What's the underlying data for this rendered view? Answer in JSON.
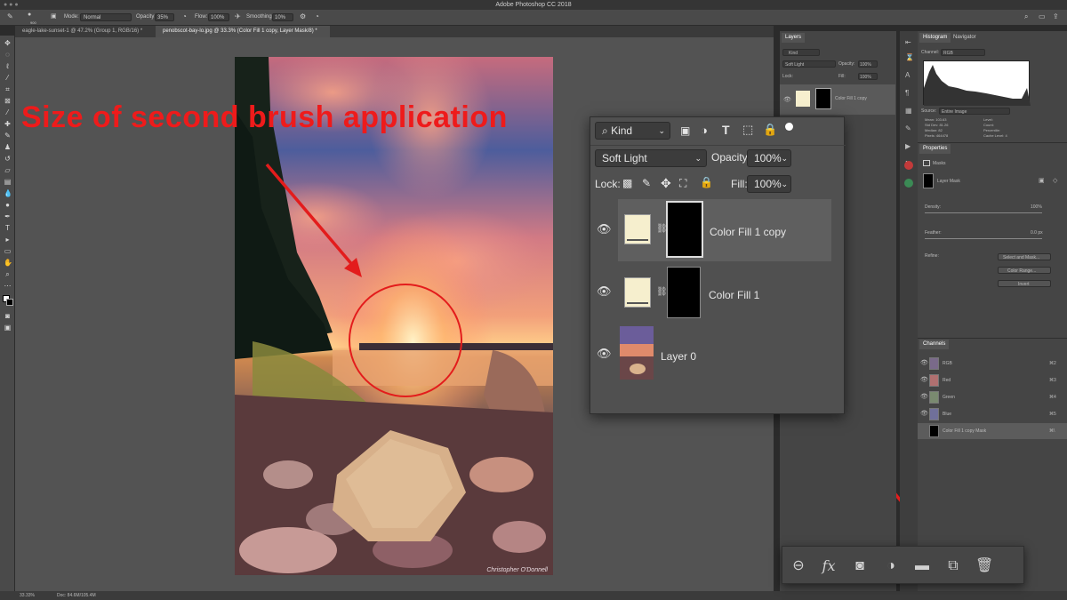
{
  "app": {
    "title": "Adobe Photoshop CC 2018"
  },
  "options_bar": {
    "brush_size": "900",
    "mode_label": "Mode:",
    "mode_value": "Normal",
    "opacity_label": "Opacity:",
    "opacity_value": "35%",
    "flow_label": "Flow:",
    "flow_value": "100%",
    "smoothing_label": "Smoothing:",
    "smoothing_value": "10%"
  },
  "tabs": [
    {
      "label": "eagle-lake-sunset-1 @ 47.2% (Group 1, RGB/16) *"
    },
    {
      "label": "penobscot-bay-lo.jpg @ 33.3% (Color Fill 1 copy, Layer Mask/8) *"
    }
  ],
  "annotation": {
    "text": "Size of second brush application"
  },
  "photo": {
    "watermark": "Christopher O'Donnell"
  },
  "status": {
    "zoom": "33.33%",
    "doc": "Doc: 84.6M/105.4M"
  },
  "layers_panel_small": {
    "tab": "Layers",
    "kind": "Kind",
    "blend": "Soft Light",
    "opacity_label": "Opacity:",
    "opacity_value": "100%",
    "lock_label": "Lock:",
    "fill_label": "Fill:",
    "fill_value": "100%",
    "layer_name": "Color Fill 1 copy"
  },
  "right_panel": {
    "tab_histogram": "Histogram",
    "tab_navigator": "Navigator",
    "channel_label": "Channel:",
    "channel_value": "RGB",
    "source_label": "Source:",
    "source_value": "Entire Image",
    "stats_left": [
      "Mean: 103.63",
      "Std Dev: 81.26",
      "Median: 82",
      "Pixels: 464478"
    ],
    "stats_right": [
      "Level:",
      "Count:",
      "Percentile:",
      "Cache Level: 4"
    ],
    "properties_tab": "Properties",
    "masks_label": "Masks",
    "layer_mask_label": "Layer Mask",
    "density_label": "Density:",
    "density_value": "100%",
    "feather_label": "Feather:",
    "feather_value": "0.0 px",
    "refine_label": "Refine:",
    "btn_select_mask": "Select and Mask...",
    "btn_color_range": "Color Range...",
    "btn_invert": "Invert",
    "channels_tab": "Channels",
    "channels": [
      {
        "name": "RGB",
        "key": "⌘2"
      },
      {
        "name": "Red",
        "key": "⌘3"
      },
      {
        "name": "Green",
        "key": "⌘4"
      },
      {
        "name": "Blue",
        "key": "⌘5"
      },
      {
        "name": "Color Fill 1 copy Mask",
        "key": "⌘\\"
      }
    ]
  },
  "zoom_panel": {
    "kind": "Kind",
    "blend": "Soft Light",
    "opacity_label": "Opacity:",
    "opacity_value": "100%",
    "lock_label": "Lock:",
    "fill_label": "Fill:",
    "fill_value": "100%",
    "layers": [
      {
        "name": "Color Fill 1 copy",
        "selected": true
      },
      {
        "name": "Color Fill 1",
        "selected": false
      },
      {
        "name": "Layer 0",
        "selected": false
      }
    ]
  },
  "bottom_bar": {
    "icons": [
      "link-layers-icon",
      "fx-icon",
      "add-mask-icon",
      "adjustment-layer-icon",
      "group-folder-icon",
      "new-layer-icon",
      "trash-icon"
    ],
    "fx_label": "fx"
  },
  "colors": {
    "annotation_red": "#ee1b1b",
    "ui_dark": "#454545",
    "canvas_gray": "#535353"
  }
}
